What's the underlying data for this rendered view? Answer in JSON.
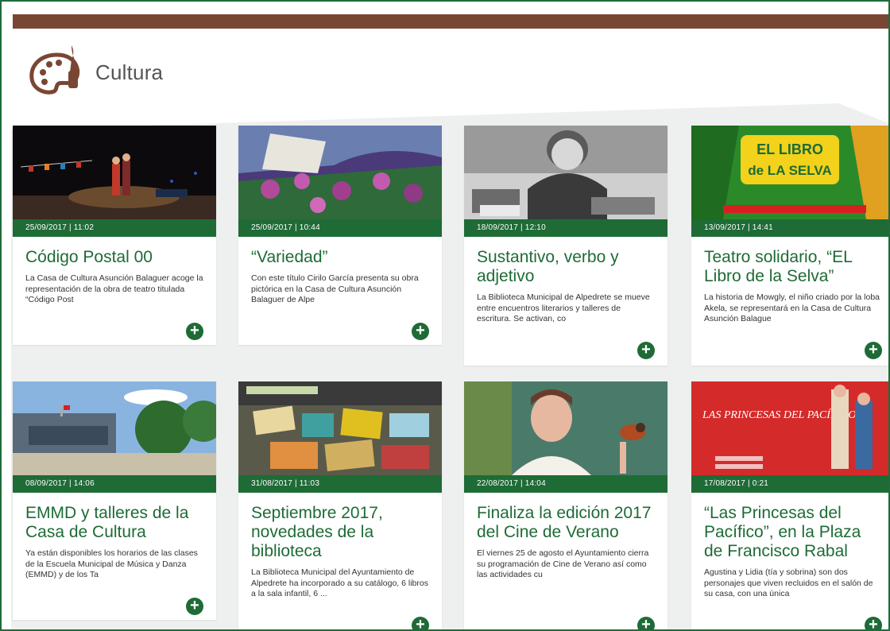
{
  "section": {
    "title": "Cultura",
    "logo_icon": "palette-icon"
  },
  "colors": {
    "brand_green": "#1e6b36",
    "top_bar": "#7a4634"
  },
  "cards": [
    {
      "date": "25/09/2017  |  11:02",
      "title": "Código Postal 00",
      "excerpt": "La Casa de Cultura Asunción Balaguer acoge la representación de la obra de teatro titulada “Código Post"
    },
    {
      "date": "25/09/2017  |  10:44",
      "title": "“Variedad”",
      "excerpt": "Con este título Cirilo García presenta su obra pictórica en la Casa de Cultura Asunción Balaguer de Alpe"
    },
    {
      "date": "18/09/2017  |  12:10",
      "title": "Sustantivo, verbo y adjetivo",
      "excerpt": "La Biblioteca Municipal de Alpedrete se mueve entre encuentros literarios y talleres de escritura. Se activan, co"
    },
    {
      "date": "13/09/2017  |  14:41",
      "title": "Teatro solidario, “EL Libro de la Selva”",
      "excerpt": "La historia de Mowgly, el niño criado por la loba Akela, se representará en la Casa de Cultura Asunción Balague"
    },
    {
      "date": "08/09/2017  |  14:06",
      "title": "EMMD y talleres de la Casa de Cultura",
      "excerpt": "Ya están disponibles los horarios de las clases de la Escuela Municipal de Música y Danza (EMMD) y de los Ta"
    },
    {
      "date": "31/08/2017  |  11:03",
      "title": "Septiembre 2017, novedades de la biblioteca",
      "excerpt": "La Biblioteca Municipal del Ayuntamiento de Alpedrete ha incorporado a su catálogo, 6 libros a la sala infantil, 6 ..."
    },
    {
      "date": "22/08/2017  |  14:04",
      "title": "Finaliza la edición 2017 del Cine de Verano",
      "excerpt": "El viernes 25 de agosto el Ayuntamiento cierra su programación de Cine de Verano así como las actividades cu"
    },
    {
      "date": "17/08/2017  |  0:21",
      "title": "“Las Princesas del Pacífico”, en la Plaza de Francisco Rabal",
      "excerpt": "Agustina y Lidia (tía y sobrina) son dos personajes que viven recluidos en el salón de su casa, con una única"
    }
  ],
  "images": {
    "selva_line1": "EL LIBRO",
    "selva_line2": "de LA SELVA",
    "princesas_title": "LAS PRINCESAS DEL PACÍFICO"
  },
  "more_icon": "plus-circle-icon"
}
